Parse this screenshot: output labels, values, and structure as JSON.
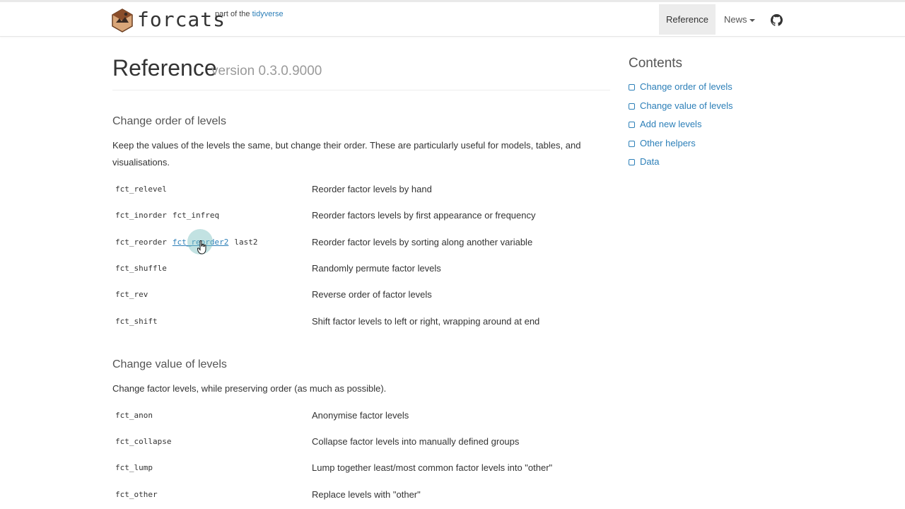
{
  "navbar": {
    "brand": "forcats",
    "part_of": "part of the",
    "tidyverse": "tidyverse",
    "reference": "Reference",
    "news": "News",
    "github_icon": "github-icon"
  },
  "header": {
    "title": "Reference",
    "version": "version 0.3.0.9000"
  },
  "sections": [
    {
      "title": "Change order of levels",
      "desc": "Keep the values of the levels the same, but change their order. These are particularly useful for models, tables, and visualisations.",
      "rows": [
        {
          "funcs": [
            "fct_relevel"
          ],
          "desc": "Reorder factor levels by hand"
        },
        {
          "funcs": [
            "fct_inorder",
            "fct_infreq"
          ],
          "desc": "Reorder factors levels by first appearance or frequency"
        },
        {
          "funcs": [
            "fct_reorder",
            "fct_reorder2",
            "last2"
          ],
          "desc": "Reorder factor levels by sorting along another variable"
        },
        {
          "funcs": [
            "fct_shuffle"
          ],
          "desc": "Randomly permute factor levels"
        },
        {
          "funcs": [
            "fct_rev"
          ],
          "desc": "Reverse order of factor levels"
        },
        {
          "funcs": [
            "fct_shift"
          ],
          "desc": "Shift factor levels to left or right, wrapping around at end"
        }
      ]
    },
    {
      "title": "Change value of levels",
      "desc": "Change factor levels, while preserving order (as much as possible).",
      "rows": [
        {
          "funcs": [
            "fct_anon"
          ],
          "desc": "Anonymise factor levels"
        },
        {
          "funcs": [
            "fct_collapse"
          ],
          "desc": "Collapse factor levels into manually defined groups"
        },
        {
          "funcs": [
            "fct_lump"
          ],
          "desc": "Lump together least/most common factor levels into \"other\""
        },
        {
          "funcs": [
            "fct_other"
          ],
          "desc": "Replace levels with \"other\""
        }
      ]
    }
  ],
  "sidebar": {
    "title": "Contents",
    "items": [
      "Change order of levels",
      "Change value of levels",
      "Add new levels",
      "Other helpers",
      "Data"
    ]
  },
  "colors": {
    "link": "#2c7fb8",
    "text": "#333333",
    "muted": "#9a9a9a"
  }
}
